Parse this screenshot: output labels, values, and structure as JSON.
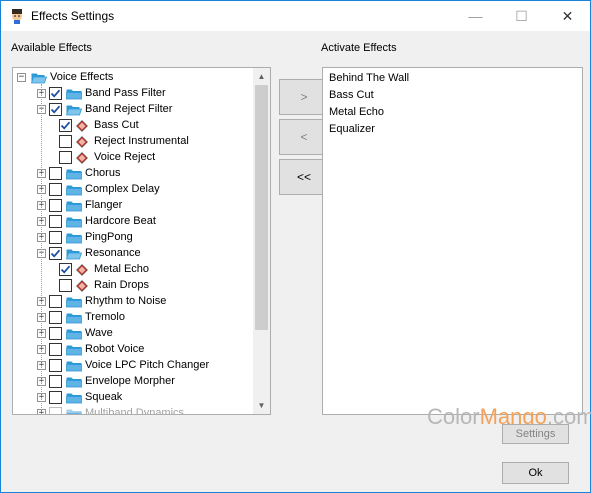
{
  "window": {
    "title": "Effects Settings",
    "minimize_glyph": "—",
    "maximize_glyph": "☐",
    "close_glyph": "✕"
  },
  "left_panel": {
    "label": "Available Effects",
    "tree": [
      {
        "label": "Voice Effects",
        "level": 0,
        "expander": "−",
        "checkbox": false,
        "checked": false,
        "icon": "folder-open-icon"
      },
      {
        "label": "Band Pass Filter",
        "level": 1,
        "expander": "+",
        "checkbox": true,
        "checked": true,
        "icon": "folder-icon"
      },
      {
        "label": "Band Reject Filter",
        "level": 1,
        "expander": "−",
        "checkbox": true,
        "checked": true,
        "icon": "folder-open-icon"
      },
      {
        "label": "Bass Cut",
        "level": 2,
        "expander": "",
        "checkbox": true,
        "checked": true,
        "icon": "effect-icon"
      },
      {
        "label": "Reject Instrumental",
        "level": 2,
        "expander": "",
        "checkbox": true,
        "checked": false,
        "icon": "effect-icon"
      },
      {
        "label": "Voice Reject",
        "level": 2,
        "expander": "",
        "checkbox": true,
        "checked": false,
        "icon": "effect-icon"
      },
      {
        "label": "Chorus",
        "level": 1,
        "expander": "+",
        "checkbox": true,
        "checked": false,
        "icon": "folder-icon"
      },
      {
        "label": "Complex Delay",
        "level": 1,
        "expander": "+",
        "checkbox": true,
        "checked": false,
        "icon": "folder-icon"
      },
      {
        "label": "Flanger",
        "level": 1,
        "expander": "+",
        "checkbox": true,
        "checked": false,
        "icon": "folder-icon"
      },
      {
        "label": "Hardcore Beat",
        "level": 1,
        "expander": "+",
        "checkbox": true,
        "checked": false,
        "icon": "folder-icon"
      },
      {
        "label": "PingPong",
        "level": 1,
        "expander": "+",
        "checkbox": true,
        "checked": false,
        "icon": "folder-icon"
      },
      {
        "label": "Resonance",
        "level": 1,
        "expander": "−",
        "checkbox": true,
        "checked": true,
        "icon": "folder-open-icon"
      },
      {
        "label": "Metal Echo",
        "level": 2,
        "expander": "",
        "checkbox": true,
        "checked": true,
        "icon": "effect-icon"
      },
      {
        "label": "Rain Drops",
        "level": 2,
        "expander": "",
        "checkbox": true,
        "checked": false,
        "icon": "effect-icon"
      },
      {
        "label": "Rhythm to Noise",
        "level": 1,
        "expander": "+",
        "checkbox": true,
        "checked": false,
        "icon": "folder-icon"
      },
      {
        "label": "Tremolo",
        "level": 1,
        "expander": "+",
        "checkbox": true,
        "checked": false,
        "icon": "folder-icon"
      },
      {
        "label": "Wave",
        "level": 1,
        "expander": "+",
        "checkbox": true,
        "checked": false,
        "icon": "folder-icon"
      },
      {
        "label": "Robot Voice",
        "level": 1,
        "expander": "+",
        "checkbox": true,
        "checked": false,
        "icon": "folder-icon"
      },
      {
        "label": "Voice LPC Pitch Changer",
        "level": 1,
        "expander": "+",
        "checkbox": true,
        "checked": false,
        "icon": "folder-icon"
      },
      {
        "label": "Envelope Morpher",
        "level": 1,
        "expander": "+",
        "checkbox": true,
        "checked": false,
        "icon": "folder-icon"
      },
      {
        "label": "Squeak",
        "level": 1,
        "expander": "+",
        "checkbox": true,
        "checked": false,
        "icon": "folder-icon"
      },
      {
        "label": "Multiband Dynamics",
        "level": 1,
        "expander": "+",
        "checkbox": true,
        "checked": false,
        "icon": "folder-icon",
        "dim": true
      }
    ],
    "scroll_up_glyph": "▲",
    "scroll_down_glyph": "▼"
  },
  "middle_buttons": {
    "add": ">",
    "remove": "<",
    "remove_all": "<<"
  },
  "right_panel": {
    "label": "Activate Effects",
    "items": [
      "Behind The Wall",
      "Bass Cut",
      "Metal Echo",
      "Equalizer"
    ]
  },
  "settings_button": "Settings",
  "ok_button": "Ok",
  "watermark": {
    "part1": "Color",
    "part2": "Mango",
    "part3": ".com"
  },
  "colors": {
    "folder": "#2d9ad6",
    "checkmark": "#1f4fa3",
    "effect_icon": "#c0392b",
    "accent": "#f2a25a"
  }
}
